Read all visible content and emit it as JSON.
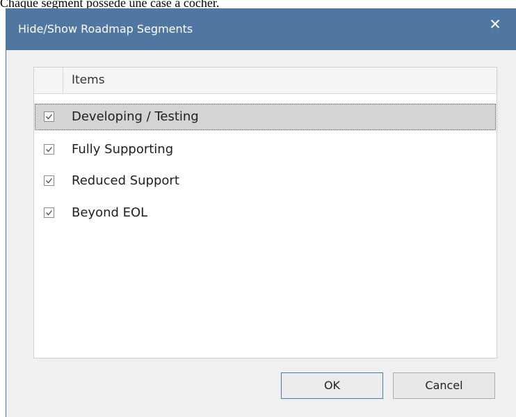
{
  "caption": "Chaque segment possède une case à cocher.",
  "dialog": {
    "title": "Hide/Show Roadmap Segments",
    "close_icon": "close-icon",
    "list": {
      "header": "Items",
      "items": [
        {
          "label": "Developing / Testing",
          "checked": true,
          "selected": true
        },
        {
          "label": "Fully Supporting",
          "checked": true,
          "selected": false
        },
        {
          "label": "Reduced Support",
          "checked": true,
          "selected": false
        },
        {
          "label": "Beyond EOL",
          "checked": true,
          "selected": false
        }
      ]
    },
    "buttons": {
      "ok_label": "OK",
      "cancel_label": "Cancel"
    }
  },
  "colors": {
    "titlebar": "#5076a2",
    "selection": "#d4d4d4",
    "ok_border": "#3c7fb1"
  }
}
